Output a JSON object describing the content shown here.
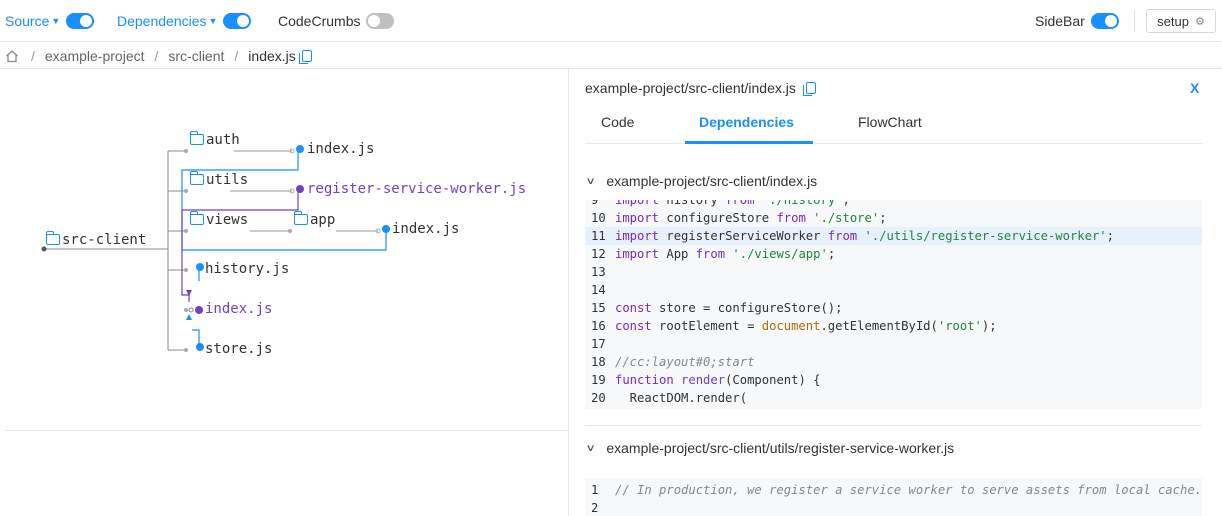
{
  "topbar": {
    "source_label": "Source",
    "dependencies_label": "Dependencies",
    "codecrumbs_label": "CodeCrumbs",
    "sidebar_label": "SideBar",
    "setup_label": "setup"
  },
  "breadcrumb": {
    "items": [
      "example-project",
      "src-client",
      "index.js"
    ],
    "separator": "/"
  },
  "graph": {
    "root": "src-client",
    "folders": [
      "auth",
      "utils",
      "views",
      "app"
    ],
    "files": {
      "auth_index": "index.js",
      "register": "register-service-worker.js",
      "app_index": "index.js",
      "history": "history.js",
      "index": "index.js",
      "store": "store.js"
    }
  },
  "panel": {
    "path": "example-project/src-client/index.js",
    "close_label": "X",
    "tabs": [
      "Code",
      "Dependencies",
      "FlowChart"
    ],
    "active_tab": "Dependencies",
    "sections": [
      {
        "title": "example-project/src-client/index.js",
        "lines": [
          {
            "n": "9",
            "text": "import history from './history';"
          },
          {
            "n": "10",
            "text": "import configureStore from './store';"
          },
          {
            "n": "11",
            "text": "import registerServiceWorker from './utils/register-service-worker';",
            "highlight": true
          },
          {
            "n": "12",
            "text": "import App from './views/app';"
          },
          {
            "n": "13",
            "text": ""
          },
          {
            "n": "14",
            "text": ""
          },
          {
            "n": "15",
            "text": "const store = configureStore();"
          },
          {
            "n": "16",
            "text": "const rootElement = document.getElementById('root');"
          },
          {
            "n": "17",
            "text": ""
          },
          {
            "n": "18",
            "text": "//cc:layout#0;start"
          },
          {
            "n": "19",
            "text": "function render(Component) {"
          },
          {
            "n": "20",
            "text": "  ReactDOM.render("
          }
        ]
      },
      {
        "title": "example-project/src-client/utils/register-service-worker.js",
        "lines": [
          {
            "n": "1",
            "text": "// In production, we register a service worker to serve assets from local cache."
          },
          {
            "n": "2",
            "text": ""
          }
        ]
      }
    ]
  },
  "colors": {
    "accent": "#1890ff",
    "purple": "#6f42c1",
    "string": "#22863a",
    "keyword": "#7c2ab8",
    "toggle_off": "#bfbfbf"
  }
}
